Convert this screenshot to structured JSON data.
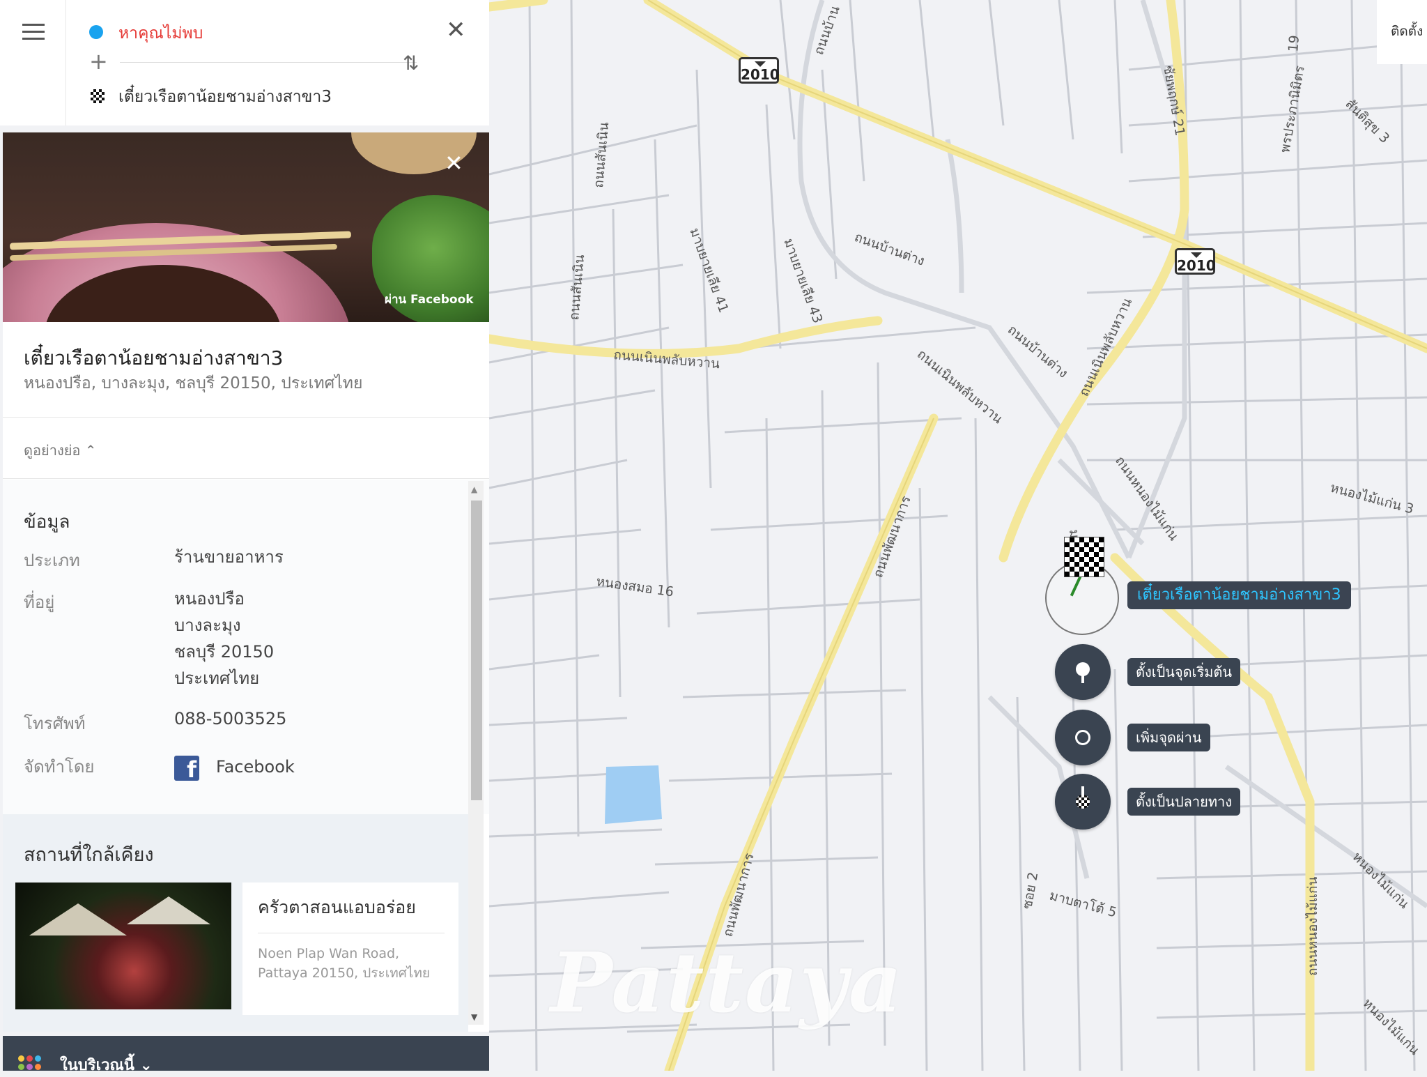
{
  "route": {
    "start_text": "หาคุณไม่พบ",
    "destination_text": "เตี๋ยวเรือตาน้อยชามอ่างสาขา3",
    "plus_glyph": "+",
    "swap_glyph": "⇅",
    "close_glyph": "✕"
  },
  "place": {
    "photo_credit": "ผ่าน Facebook",
    "photo_close_glyph": "✕",
    "name": "เตี๋ยวเรือตาน้อยชามอ่างสาขา3",
    "address": "หนองปรือ, บางละมุง, ชลบุรี 20150, ประเทศไทย",
    "collapse_label": "ดูอย่างย่อ ⌃"
  },
  "info": {
    "title": "ข้อมูล",
    "rows": [
      {
        "label": "ประเภท",
        "value": "ร้านขายอาหาร"
      },
      {
        "label": "ที่อยู่",
        "lines": [
          "หนองปรือ",
          "บางละมุง",
          "ชลบุรี 20150",
          "ประเทศไทย"
        ]
      },
      {
        "label": "โทรศัพท์",
        "value": "088-5003525"
      },
      {
        "label": "จัดทำโดย",
        "value": "Facebook"
      }
    ]
  },
  "nearby": {
    "title": "สถานที่ใกล้เคียง",
    "items": [
      {
        "name": "ครัวตาสอนแอบอร่อย",
        "address": "Noen Plap Wan Road, Pattaya 20150, ประเทศไทย"
      }
    ]
  },
  "bottom_bar": {
    "label": "ในบริเวณนี้ ⌄"
  },
  "map": {
    "corner_button": "ติดตั้ง",
    "watermark": "Pattaya",
    "marker_label": "เตี๋ยวเรือตาน้อยชามอ่างสาขา3",
    "actions": [
      {
        "label": "ตั้งเป็นจุดเริ่มต้น",
        "icon": "start-pin-icon"
      },
      {
        "label": "เพิ่มจุดผ่าน",
        "icon": "waypoint-circle-icon"
      },
      {
        "label": "ตั้งเป็นปลายทาง",
        "icon": "destination-flag-icon"
      }
    ],
    "shields": [
      "2010",
      "2010"
    ],
    "road_labels": [
      "ถนนบ้าน",
      "ถนนสันเนิน",
      "ถนนสันเนิน",
      "มาบยายเลีย 41",
      "มาบยายเลีย 43",
      "ถนนบ้านต่าง",
      "ถนนเนินพลับหวาน",
      "ถนนเนินพลับหวาน",
      "ถนนบ้านต่าง",
      "ถนนเนินพลับหวาน",
      "ชัยพฤกษ์ 21",
      "19",
      "พรประภานิมิตร",
      "สันติสุข 3",
      "ถนนหนองไม้แก่น",
      "หนองไม้แก่น 3",
      "ถนนพัฒนาการ",
      "หนองสมอ 16",
      "มาบตาโต้ 5",
      "ซอย 2",
      "ถนนพัฒนาการ",
      "ถนนหนองไม้แก่น",
      "หนองไม้แก่น",
      "หนองไม้แก่น",
      "มาบยา"
    ]
  },
  "colors": {
    "accent_blue": "#1aa3ef",
    "start_red": "#e53935",
    "dark_chip": "#3a4451",
    "marker_label_text": "#2ec5ff",
    "major_road": "#f4e79a"
  }
}
